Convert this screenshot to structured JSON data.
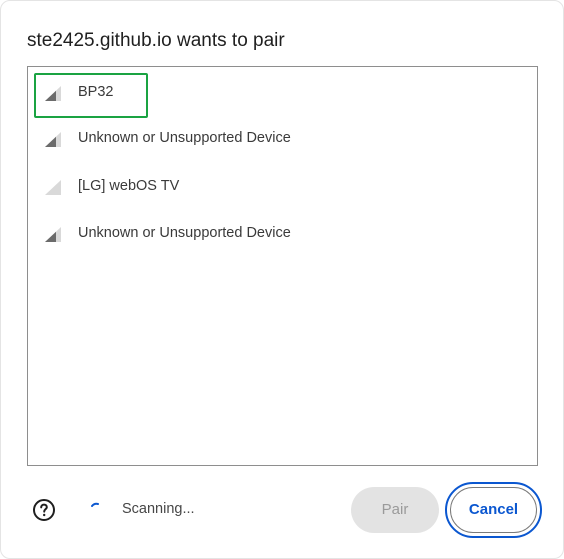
{
  "dialog": {
    "title": "ste2425.github.io wants to pair"
  },
  "devices": [
    {
      "name": "BP32",
      "signal": "medium",
      "selected": true
    },
    {
      "name": "Unknown or Unsupported Device",
      "signal": "medium",
      "selected": false
    },
    {
      "name": "[LG] webOS TV",
      "signal": "weak",
      "selected": false
    },
    {
      "name": "Unknown or Unsupported Device",
      "signal": "medium",
      "selected": false
    }
  ],
  "footer": {
    "help_icon": "help-circle-icon",
    "status_text": "Scanning...",
    "pair_label": "Pair",
    "cancel_label": "Cancel"
  },
  "colors": {
    "selection_outline": "#1aa342",
    "accent_blue": "#0b57d0",
    "disabled_bg": "#e3e3e3"
  }
}
